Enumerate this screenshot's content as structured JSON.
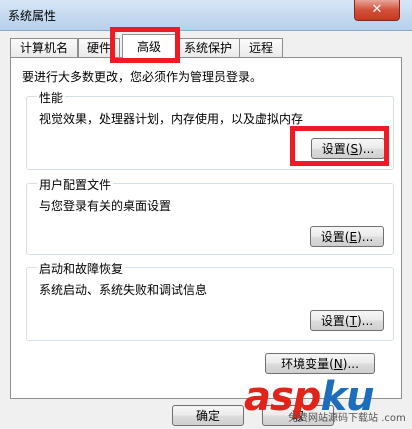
{
  "window": {
    "title": "系统属性",
    "close_glyph": "✕"
  },
  "tabs": [
    {
      "label": "计算机名"
    },
    {
      "label": "硬件"
    },
    {
      "label": "高级"
    },
    {
      "label": "系统保护"
    },
    {
      "label": "远程"
    }
  ],
  "notice": "要进行大多数更改，您必须作为管理员登录。",
  "performance": {
    "title": "性能",
    "description": "视觉效果，处理器计划，内存使用，以及虚拟内存",
    "button": {
      "text": "设置",
      "key": "S",
      "suffix": "..."
    }
  },
  "user_profiles": {
    "title": "用户配置文件",
    "description": "与您登录有关的桌面设置",
    "button": {
      "text": "设置",
      "key": "E",
      "suffix": "..."
    }
  },
  "startup": {
    "title": "启动和故障恢复",
    "description": "系统启动、系统失败和调试信息",
    "button": {
      "text": "设置",
      "key": "T",
      "suffix": "..."
    }
  },
  "env_button": {
    "text": "环境变量",
    "key": "N",
    "suffix": "..."
  },
  "footer": {
    "ok": "确定",
    "cancel": "取"
  },
  "watermark": {
    "brand_a": "asp",
    "brand_b": "ku",
    "domain": ".com",
    "tagline": "免费网站源码下载站"
  }
}
